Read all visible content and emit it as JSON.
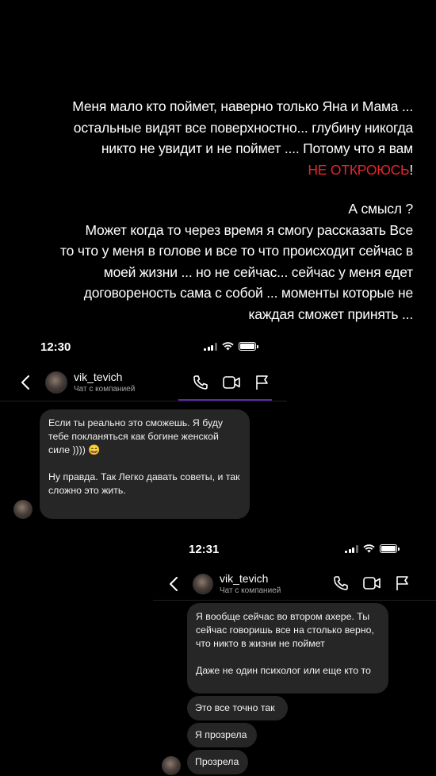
{
  "story": {
    "lines": [
      "Меня мало кто поймет, наверно только Яна и Мама ...",
      "остальные видят все поверхностно... глубину никогда",
      "никто не увидит и не поймет .... Потому что я вам",
      "",
      "А смысл ?",
      "Может когда то через время я смогу рассказать  Все",
      "то что у меня в голове и все то что происходит сейчас в",
      "моей жизни ... но не сейчас... сейчас  у меня едет",
      "договореность сама с собой ... моменты которые не",
      "каждая сможет принять ..."
    ],
    "red_phrase": "НЕ ОТКРОЮСЬ",
    "red_suffix": "!",
    "colors": {
      "text": "#ffffff",
      "accent_red": "#e8242b"
    }
  },
  "shot1": {
    "time": "12:30",
    "back_icon": "chevron-left-icon",
    "username": "vik_tevich",
    "subtitle": "Чат с компанией",
    "icons": [
      "phone-icon",
      "video-icon",
      "flag-icon"
    ],
    "message": {
      "text1": "Если ты реально это сможешь. Я буду тебе покланяться как богине женской силе ))))",
      "emoji": "😄",
      "text2": "Ну правда. Так Легко давать советы, и так сложно это жить."
    }
  },
  "shot2": {
    "time": "12:31",
    "back_icon": "chevron-left-icon",
    "username": "vik_tevich",
    "subtitle": "Чат с компанией",
    "icons": [
      "phone-icon",
      "video-icon",
      "flag-icon"
    ],
    "messages": [
      {
        "text1": "Я вообще сейчас во втором ахере. Ты сейчас говоришь все на столько верно, что никто в жизни не поймет",
        "text2": "Даже не один психолог или еще кто то"
      },
      {
        "text": "Это все точно так"
      },
      {
        "text": "Я прозрела"
      },
      {
        "text": "Прозрела"
      }
    ]
  },
  "colors": {
    "background": "#000000",
    "bubble": "#262626",
    "subtext": "#a7a7a7",
    "accent_line": "#5a2aa8"
  }
}
